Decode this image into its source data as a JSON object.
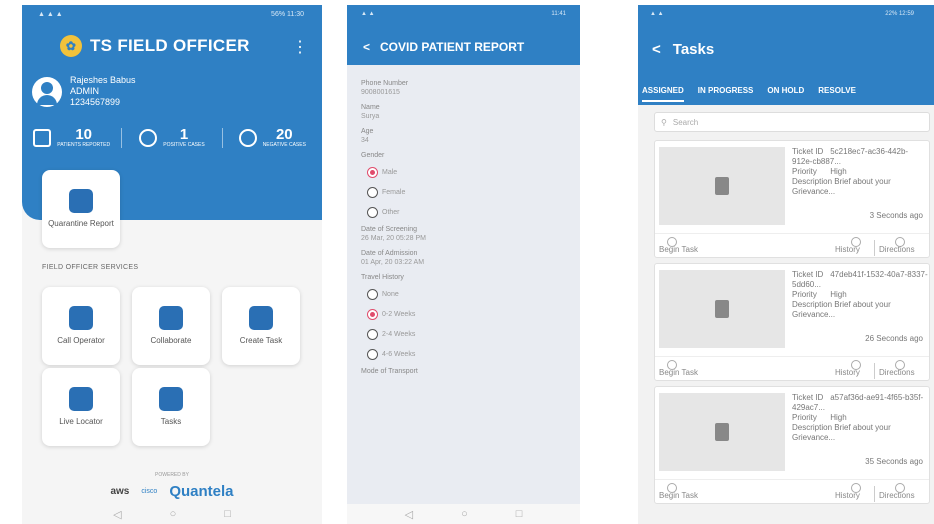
{
  "phone1": {
    "status_left": "▲ ▲ ▲",
    "status_right": "56% 11:30",
    "app_title": "TS FIELD OFFICER",
    "user": {
      "name": "Rajeshes Babus",
      "role": "ADMIN",
      "phone": "1234567899"
    },
    "stats": [
      {
        "num": "10",
        "label": "PATIENTS REPORTED"
      },
      {
        "num": "1",
        "label": "POSITIVE CASES"
      },
      {
        "num": "20",
        "label": "NEGATIVE CASES"
      }
    ],
    "tiles": {
      "quarantine": "Quarantine Report",
      "services_heading": "FIELD OFFICER SERVICES",
      "call": "Call Operator",
      "collaborate": "Collaborate",
      "create": "Create Task",
      "live": "Live Locator",
      "tasks": "Tasks"
    },
    "powered_by": "POWERED BY",
    "brands": {
      "aws": "aws",
      "cisco": "cisco",
      "quantela": "Quantela"
    }
  },
  "phone2": {
    "status_left": "▲ ▲",
    "status_right": "11:41",
    "title": "COVID PATIENT REPORT",
    "fields": {
      "phone_label": "Phone Number",
      "phone_value": "9008001615",
      "name_label": "Name",
      "name_value": "Surya",
      "age_label": "Age",
      "age_value": "34",
      "gender_label": "Gender",
      "gender_options": [
        "Male",
        "Female",
        "Other"
      ],
      "screening_label": "Date of Screening",
      "screening_value": "26 Mar, 20 05:28 PM",
      "admission_label": "Date of Admission",
      "admission_value": "01 Apr, 20 03:22 AM",
      "travel_label": "Travel History",
      "travel_options": [
        "None",
        "0-2 Weeks",
        "2-4 Weeks",
        "4-6 Weeks"
      ],
      "transport_label": "Mode of Transport"
    }
  },
  "phone3": {
    "status_left": "▲ ▲",
    "status_right": "22% 12:59",
    "title": "Tasks",
    "tabs": [
      "ASSIGNED",
      "IN PROGRESS",
      "ON HOLD",
      "RESOLVE"
    ],
    "search_placeholder": "Search",
    "labels": {
      "ticket": "Ticket ID",
      "priority": "Priority",
      "description": "Description",
      "begin": "Begin Task",
      "history": "History",
      "directions": "Directions"
    },
    "cards": [
      {
        "ticket": "5c218ec7-ac36-442b-912e-cb887...",
        "priority": "High",
        "desc": "Brief about your Grievance...",
        "ago": "3 Seconds ago"
      },
      {
        "ticket": "47deb41f-1532-40a7-8337-5dd60...",
        "priority": "High",
        "desc": "Brief about your Grievance...",
        "ago": "26 Seconds ago"
      },
      {
        "ticket": "a57af36d-ae91-4f65-b35f-429ac7...",
        "priority": "High",
        "desc": "Brief about your Grievance...",
        "ago": "35 Seconds ago"
      }
    ]
  }
}
